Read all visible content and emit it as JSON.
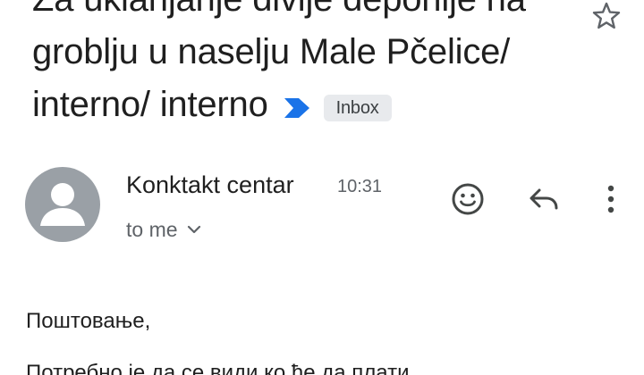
{
  "subject": {
    "line1": "Za uklanjanje divlje deponije na",
    "line2": "groblju u naselju Male Pčelice/",
    "line3": "interno/ interno",
    "label_chip": "Inbox"
  },
  "message": {
    "sender": "Konktakt centar",
    "time": "10:31",
    "recipient": "to me",
    "greeting": "Поштовање,",
    "body_line": "Потребно је да се види ко ће да плати"
  },
  "colors": {
    "importance_marker": "#1a73e8",
    "avatar_bg": "#9aa0a6",
    "chip_bg": "#e8eaed"
  },
  "icons": {
    "importance": "importance-marker-icon",
    "star": "star-icon",
    "emoji": "emoji-reaction-icon",
    "reply": "reply-icon",
    "more": "more-vert-icon",
    "expand": "chevron-down-icon",
    "avatar": "person-icon"
  }
}
